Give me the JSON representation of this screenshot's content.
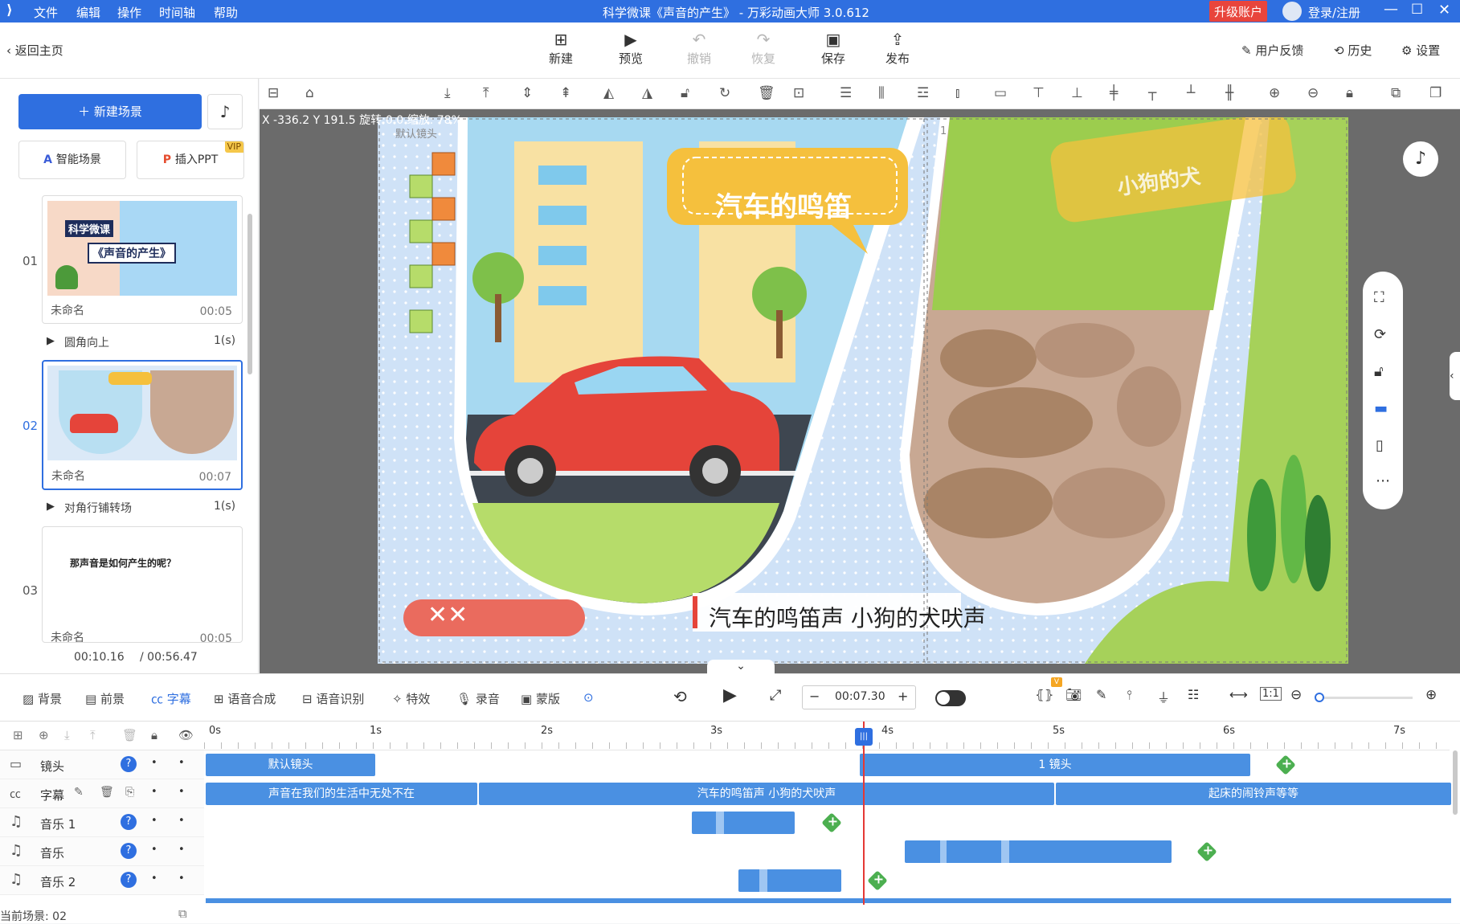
{
  "app": {
    "title": "科学微课《声音的产生》 - 万彩动画大师 3.0.612",
    "menu": [
      "文件",
      "编辑",
      "操作",
      "时间轴",
      "帮助"
    ],
    "upgrade": "升级账户",
    "login": "登录/注册",
    "accent": "#2f6fe0"
  },
  "toolbar": {
    "back": "返回主页",
    "buttons": [
      {
        "label": "新建",
        "icon": "plus-box-icon"
      },
      {
        "label": "预览",
        "icon": "play-icon"
      },
      {
        "label": "撤销",
        "icon": "undo-icon",
        "disabled": true
      },
      {
        "label": "恢复",
        "icon": "redo-icon",
        "disabled": true
      },
      {
        "label": "保存",
        "icon": "save-icon"
      },
      {
        "label": "发布",
        "icon": "publish-icon"
      }
    ],
    "feedback": "用户反馈",
    "history": "历史",
    "settings": "设置"
  },
  "left": {
    "new_scene": "新建场景",
    "smart_scene": "智能场景",
    "insert_ppt": "插入PPT",
    "vip": "VIP",
    "scenes": [
      {
        "num": "01",
        "name": "未命名",
        "time": "00:05",
        "transition": "圆角向上",
        "trans_time": "1(s)",
        "thumb_text_1": "科学微课",
        "thumb_text_2": "《声音的产生》"
      },
      {
        "num": "02",
        "name": "未命名",
        "time": "00:07",
        "transition": "对角行铺转场",
        "trans_time": "1(s)"
      },
      {
        "num": "03",
        "name": "未命名",
        "time": "00:05",
        "thumb_text_1": "那声音是如何产生的呢？"
      }
    ],
    "current_time": "00:10.16",
    "total_time": "/ 00:56.47"
  },
  "canvas": {
    "coords": "X -336.2 Y 191.5 旋转:0.0 缩放: 78%",
    "default_cam": "默认镜头",
    "cam1": "1",
    "bubble1": "汽车的鸣笛",
    "bubble2": "小狗的犬",
    "subtitle": "汽车的鸣笛声 小狗的犬吠声",
    "xx": "✕✕"
  },
  "bottom_tools": [
    "背景",
    "前景",
    "字幕",
    "语音合成",
    "语音识别",
    "特效",
    "录音",
    "蒙版"
  ],
  "playback": {
    "time": "00:07.30",
    "vip_badge": "V"
  },
  "timeline": {
    "ruler": [
      "0s",
      "1s",
      "2s",
      "3s",
      "4s",
      "5s",
      "6s",
      "7s"
    ],
    "tracks": [
      {
        "name": "镜头"
      },
      {
        "name": "字幕"
      },
      {
        "name": "音乐 1"
      },
      {
        "name": "音乐"
      },
      {
        "name": "音乐 2"
      }
    ],
    "camera_blocks": [
      "默认镜头",
      "1 镜头"
    ],
    "subtitle_blocks": [
      "声音在我们的生活中无处不在",
      "汽车的鸣笛声 小狗的犬吠声",
      "起床的闹铃声等等"
    ],
    "current_scene": "当前场景: 02"
  }
}
